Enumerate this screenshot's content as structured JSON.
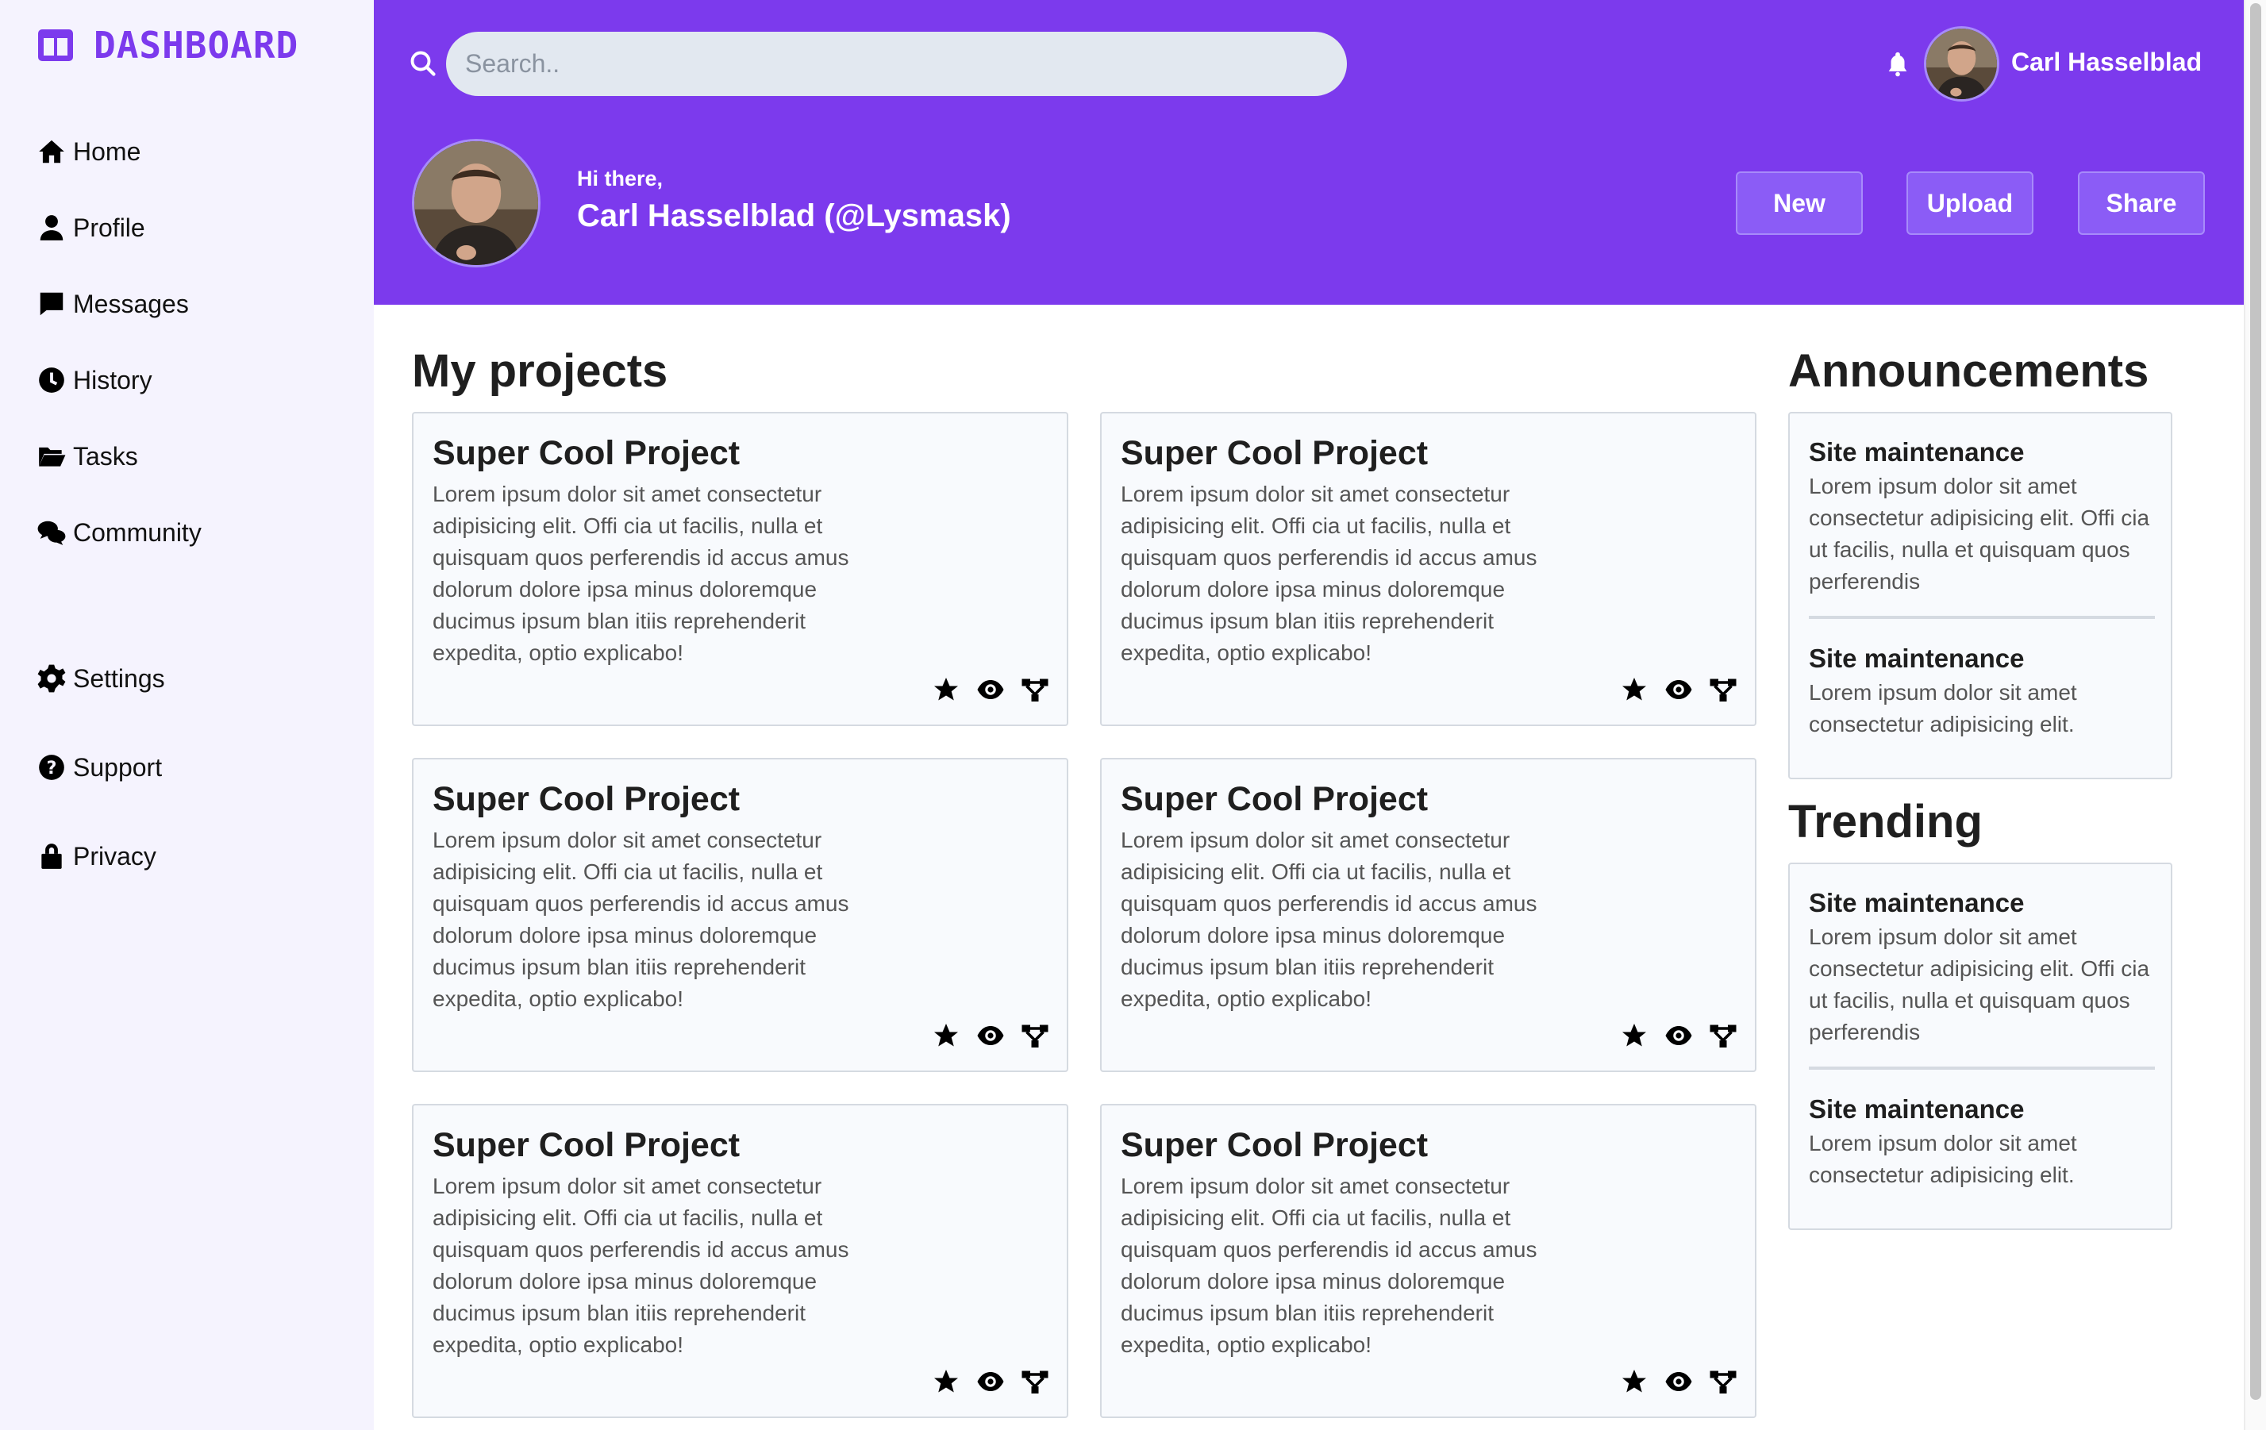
{
  "sidebar": {
    "logo_text": "DASHBOARD",
    "items": [
      {
        "label": "Home",
        "icon": "home-icon"
      },
      {
        "label": "Profile",
        "icon": "user-icon"
      },
      {
        "label": "Messages",
        "icon": "message-icon"
      },
      {
        "label": "History",
        "icon": "clock-icon"
      },
      {
        "label": "Tasks",
        "icon": "folder-icon"
      },
      {
        "label": "Community",
        "icon": "comments-icon"
      },
      {
        "label": "Settings",
        "icon": "gear-icon"
      },
      {
        "label": "Support",
        "icon": "question-icon"
      },
      {
        "label": "Privacy",
        "icon": "lock-icon"
      }
    ]
  },
  "header": {
    "search_placeholder": "Search..",
    "user_name": "Carl Hasselblad",
    "greeting": "Hi there,",
    "full_name": "Carl Hasselblad (@Lysmask)",
    "buttons": [
      "New",
      "Upload",
      "Share"
    ]
  },
  "main": {
    "projects_title": "My projects",
    "projects": [
      {
        "title": "Super Cool Project",
        "body": "Lorem ipsum dolor sit amet consectetur adipisicing elit. Offi cia ut facilis, nulla et quisquam quos perferendis id accus amus dolorum dolore ipsa minus doloremque ducimus ipsum blan itiis reprehenderit expedita, optio explicabo!"
      },
      {
        "title": "Super Cool Project",
        "body": "Lorem ipsum dolor sit amet consectetur adipisicing elit. Offi cia ut facilis, nulla et quisquam quos perferendis id accus amus dolorum dolore ipsa minus doloremque ducimus ipsum blan itiis reprehenderit expedita, optio explicabo!"
      },
      {
        "title": "Super Cool Project",
        "body": "Lorem ipsum dolor sit amet consectetur adipisicing elit. Offi cia ut facilis, nulla et quisquam quos perferendis id accus amus dolorum dolore ipsa minus doloremque ducimus ipsum blan itiis reprehenderit expedita, optio explicabo!"
      },
      {
        "title": "Super Cool Project",
        "body": "Lorem ipsum dolor sit amet consectetur adipisicing elit. Offi cia ut facilis, nulla et quisquam quos perferendis id accus amus dolorum dolore ipsa minus doloremque ducimus ipsum blan itiis reprehenderit expedita, optio explicabo!"
      },
      {
        "title": "Super Cool Project",
        "body": "Lorem ipsum dolor sit amet consectetur adipisicing elit. Offi cia ut facilis, nulla et quisquam quos perferendis id accus amus dolorum dolore ipsa minus doloremque ducimus ipsum blan itiis reprehenderit expedita, optio explicabo!"
      },
      {
        "title": "Super Cool Project",
        "body": "Lorem ipsum dolor sit amet consectetur adipisicing elit. Offi cia ut facilis, nulla et quisquam quos perferendis id accus amus dolorum dolore ipsa minus doloremque ducimus ipsum blan itiis reprehenderit expedita, optio explicabo!"
      }
    ],
    "announcements_title": "Announcements",
    "announcements": [
      {
        "title": "Site maintenance",
        "body": "Lorem ipsum dolor sit amet consectetur adipisicing elit. Offi cia ut facilis, nulla et quisquam quos perferendis"
      },
      {
        "title": "Site maintenance",
        "body": "Lorem ipsum dolor sit amet consectetur adipisicing elit."
      }
    ],
    "trending_title": "Trending",
    "trending": [
      {
        "title": "Site maintenance",
        "body": "Lorem ipsum dolor sit amet consectetur adipisicing elit. Offi cia ut facilis, nulla et quisquam quos perferendis"
      },
      {
        "title": "Site maintenance",
        "body": "Lorem ipsum dolor sit amet consectetur adipisicing elit."
      }
    ]
  },
  "colors": {
    "accent": "#7c3aed",
    "sidebar_bg": "#f5f3fe",
    "card_bg": "#f8fafd",
    "button_bg": "#8b5cf6"
  }
}
